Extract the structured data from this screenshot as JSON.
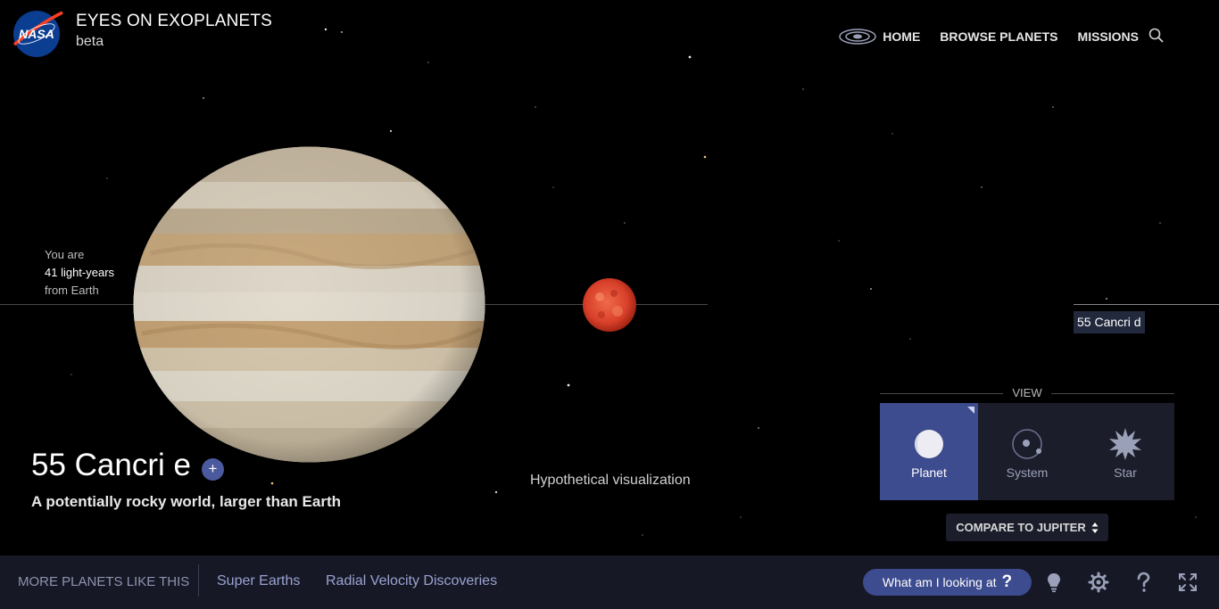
{
  "header": {
    "logo_text": "NASA",
    "app_title": "EYES ON EXOPLANETS",
    "app_subtitle": "beta",
    "nav": [
      "HOME",
      "BROWSE PLANETS",
      "MISSIONS"
    ],
    "nav_icons": [
      "galaxy-icon",
      "search-icon"
    ]
  },
  "scene": {
    "distance_prefix": "You are",
    "distance_value": "41 light-years",
    "distance_suffix": "from Earth",
    "neighbor_label": "55 Cancri d",
    "planet_name": "55 Cancri e",
    "plus_label": "+",
    "planet_description": "A potentially rocky world, larger than Earth",
    "visualization_note": "Hypothetical visualization"
  },
  "view": {
    "title": "VIEW",
    "options": [
      {
        "label": "Planet",
        "icon": "planet-icon",
        "active": true
      },
      {
        "label": "System",
        "icon": "system-icon",
        "active": false
      },
      {
        "label": "Star",
        "icon": "star-icon",
        "active": false
      }
    ],
    "compare_label": "COMPARE TO JUPITER"
  },
  "bottom": {
    "more_label": "MORE PLANETS LIKE THIS",
    "tags": [
      "Super Earths",
      "Radial Velocity Discoveries"
    ],
    "help_button": "What am I looking at",
    "help_glyph": "?",
    "icons": [
      "lightbulb-icon",
      "settings-icon",
      "help-icon",
      "fullscreen-icon"
    ]
  },
  "colors": {
    "accent": "#3d4b8f",
    "bar_bg": "#161825",
    "panel_bg": "#1b1d2a",
    "tag_text": "#9aa3d1"
  }
}
